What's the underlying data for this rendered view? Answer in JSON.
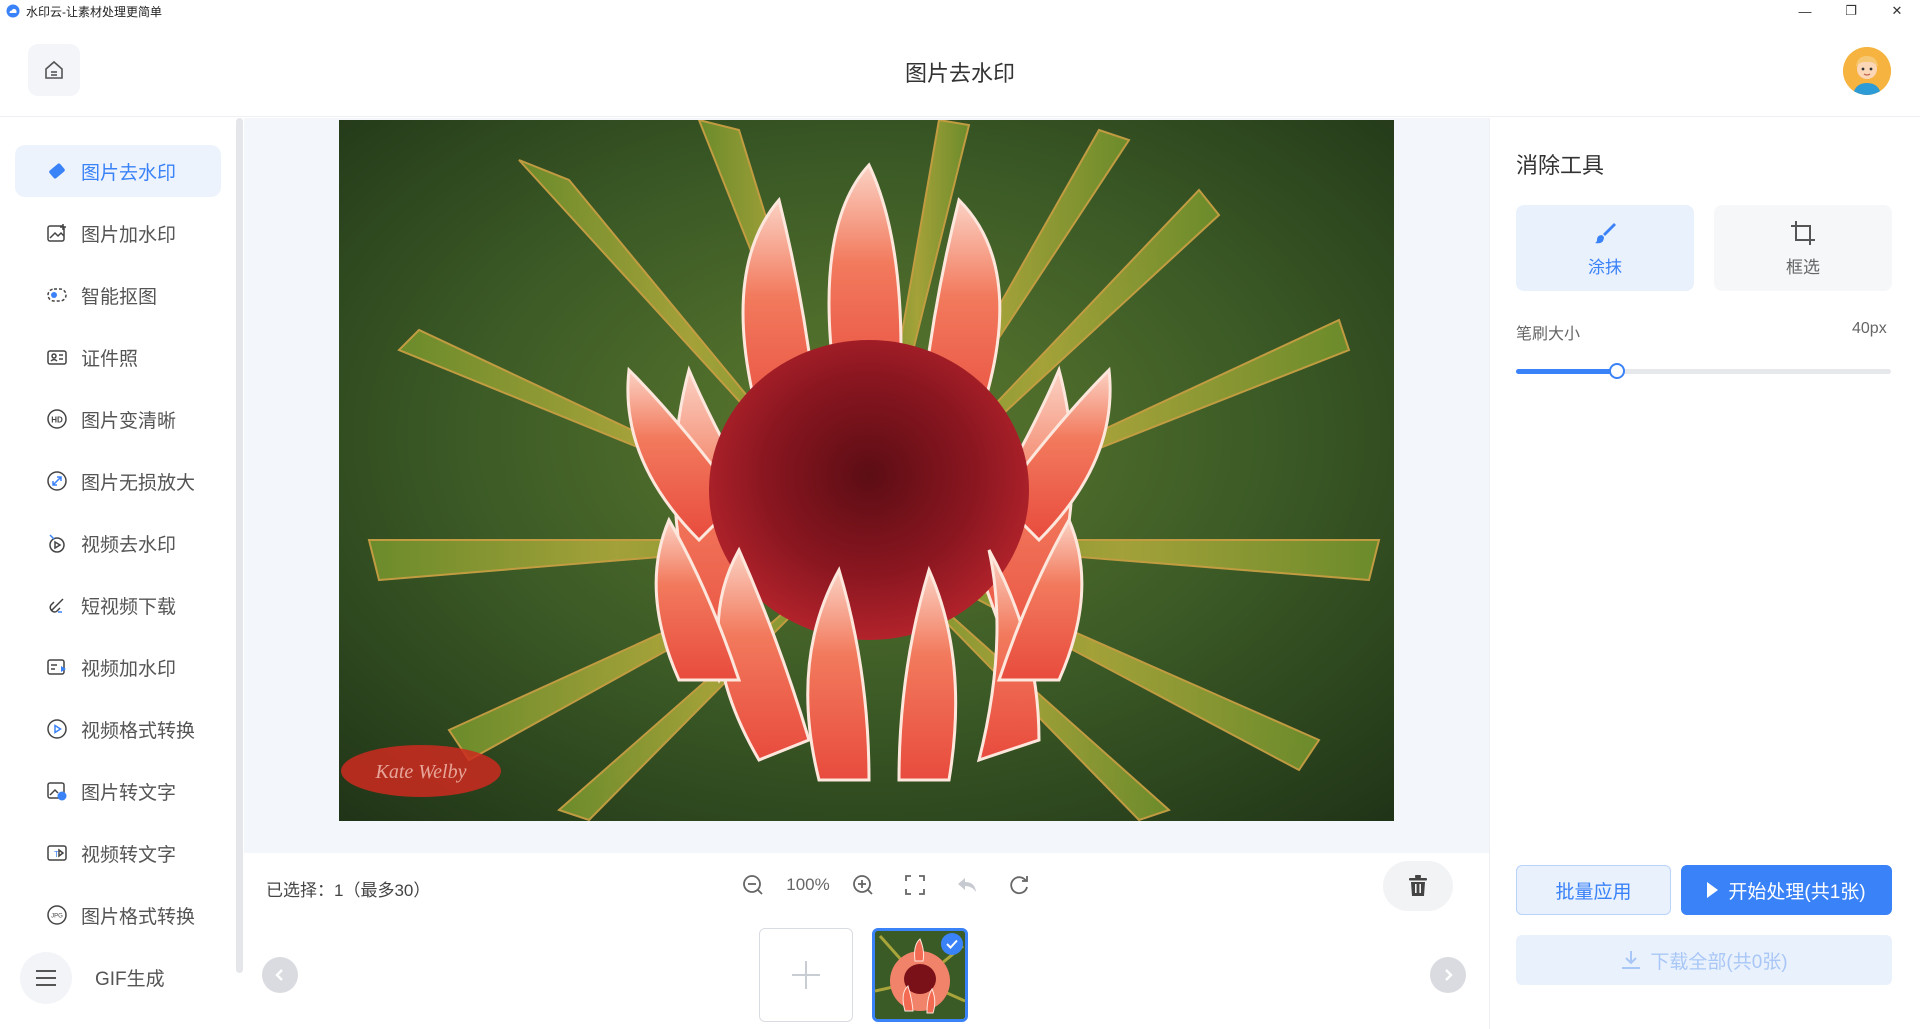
{
  "window": {
    "title": "水印云-让素材处理更简单",
    "controls": [
      "—",
      "❐",
      "✕"
    ]
  },
  "header": {
    "title": "图片去水印"
  },
  "sidebar": {
    "items": [
      {
        "label": "图片去水印",
        "icon": "eraser-icon",
        "active": true
      },
      {
        "label": "图片加水印",
        "icon": "image-add-icon"
      },
      {
        "label": "智能抠图",
        "icon": "cutout-icon"
      },
      {
        "label": "证件照",
        "icon": "id-card-icon"
      },
      {
        "label": "图片变清晰",
        "icon": "hd-icon"
      },
      {
        "label": "图片无损放大",
        "icon": "enlarge-icon"
      },
      {
        "label": "视频去水印",
        "icon": "video-eraser-icon"
      },
      {
        "label": "短视频下载",
        "icon": "link-download-icon"
      },
      {
        "label": "视频加水印",
        "icon": "video-add-icon"
      },
      {
        "label": "视频格式转换",
        "icon": "play-circle-icon"
      },
      {
        "label": "图片转文字",
        "icon": "image-text-icon"
      },
      {
        "label": "视频转文字",
        "icon": "video-text-icon"
      },
      {
        "label": "图片格式转换",
        "icon": "jpg-icon"
      },
      {
        "label": "GIF生成",
        "icon": "menu-icon"
      }
    ]
  },
  "canvas": {
    "watermark_text": "Kate Welby"
  },
  "toolbar": {
    "selected_text": "已选择：1（最多30）",
    "zoom_level": "100%"
  },
  "tools": {
    "title": "消除工具",
    "paint_label": "涂抹",
    "box_label": "框选",
    "brush_size_label": "笔刷大小",
    "brush_size_value": "40px",
    "brush_fraction": 0.27
  },
  "actions": {
    "batch_apply": "批量应用",
    "start": "开始处理(共1张)",
    "download_all": "下载全部(共0张)"
  },
  "colors": {
    "accent": "#3a82f7",
    "accent_light": "#e9f1fd"
  }
}
